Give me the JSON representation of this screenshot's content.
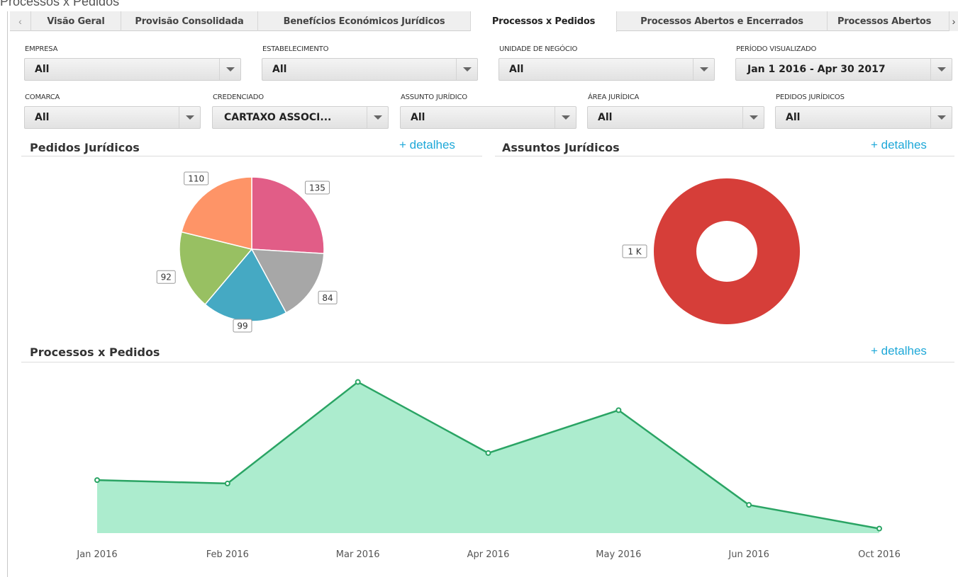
{
  "window_title": "Processos x Pedidos",
  "tabs": [
    {
      "label": "Visão Geral"
    },
    {
      "label": "Provisão Consolidada"
    },
    {
      "label": "Benefícios Económicos Jurídicos"
    },
    {
      "label": "Processos x Pedidos",
      "active": true
    },
    {
      "label": "Processos Abertos e Encerrados"
    },
    {
      "label": "Processos Abertos"
    }
  ],
  "filters": {
    "empresa": {
      "label": "EMPRESA",
      "value": "All"
    },
    "estabelecimento": {
      "label": "ESTABELECIMENTO",
      "value": "All"
    },
    "unidade": {
      "label": "UNIDADE DE NEGÓCIO",
      "value": "All"
    },
    "periodo": {
      "label": "PERÍODO VISUALIZADO",
      "value": "Jan 1 2016 - Apr 30 2017"
    },
    "comarca": {
      "label": "COMARCA",
      "value": "All"
    },
    "credenciado": {
      "label": "CREDENCIADO",
      "value": "CARTAXO ASSOCI..."
    },
    "assunto": {
      "label": "ASSUNTO JURÍDICO",
      "value": "All"
    },
    "area": {
      "label": "ÁREA JURÍDICA",
      "value": "All"
    },
    "pedidos": {
      "label": "PEDIDOS JURÍDICOS",
      "value": "All"
    }
  },
  "sections": {
    "pedidos": {
      "title": "Pedidos Jurídicos",
      "link": "+ detalhes"
    },
    "assuntos": {
      "title": "Assuntos Jurídicos",
      "link": "+ detalhes"
    },
    "processos": {
      "title": "Processos x Pedidos",
      "link": "+ detalhes"
    }
  },
  "colors": {
    "accent_link": "#1ea8d8",
    "area_fill": "#acecce",
    "area_line": "#2aa464",
    "donut": "#d63e39"
  },
  "chart_data": [
    {
      "type": "pie",
      "slices": [
        {
          "value": 135,
          "label": "135",
          "color": "#e15d87"
        },
        {
          "value": 84,
          "label": "84",
          "color": "#a7a7a7"
        },
        {
          "value": 99,
          "label": "99",
          "color": "#45a9c3"
        },
        {
          "value": 92,
          "label": "92",
          "color": "#98c062"
        },
        {
          "value": 110,
          "label": "110",
          "color": "#fe9467"
        }
      ]
    },
    {
      "type": "pie",
      "donut": true,
      "slices": [
        {
          "value": 1000,
          "label": "1 K",
          "color": "#d63e39"
        }
      ]
    },
    {
      "type": "area",
      "categories": [
        "Jan 2016",
        "Feb 2016",
        "Mar 2016",
        "Apr 2016",
        "May 2016",
        "Jun 2016",
        "Oct 2016"
      ],
      "values": [
        47,
        44,
        134,
        71,
        109,
        25,
        4
      ],
      "ylim": [
        0,
        140
      ],
      "grid": false
    }
  ]
}
